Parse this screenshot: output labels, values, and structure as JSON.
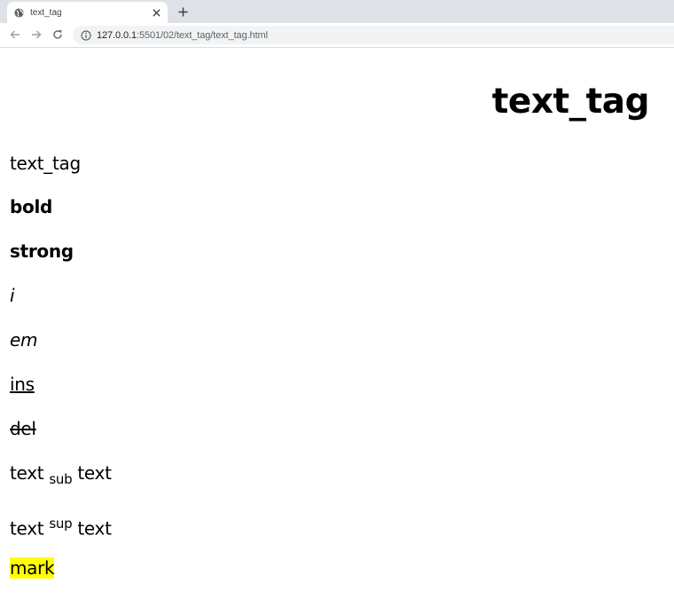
{
  "browser": {
    "tab_title": "text_tag",
    "url_host": "127.0.0.1",
    "url_path": ":5501/02/text_tag/text_tag.html"
  },
  "page": {
    "heading": "text_tag",
    "plain": "text_tag",
    "bold": "bold",
    "strong": "strong",
    "italic": "i",
    "em": "em",
    "ins": "ins",
    "del": "del",
    "sub_line": {
      "before": "text",
      "sub": "sub",
      "after": "text"
    },
    "sup_line": {
      "before": "text",
      "sup": "sup",
      "after": "text"
    },
    "mark": "mark",
    "mark_color": "#ffff00"
  }
}
